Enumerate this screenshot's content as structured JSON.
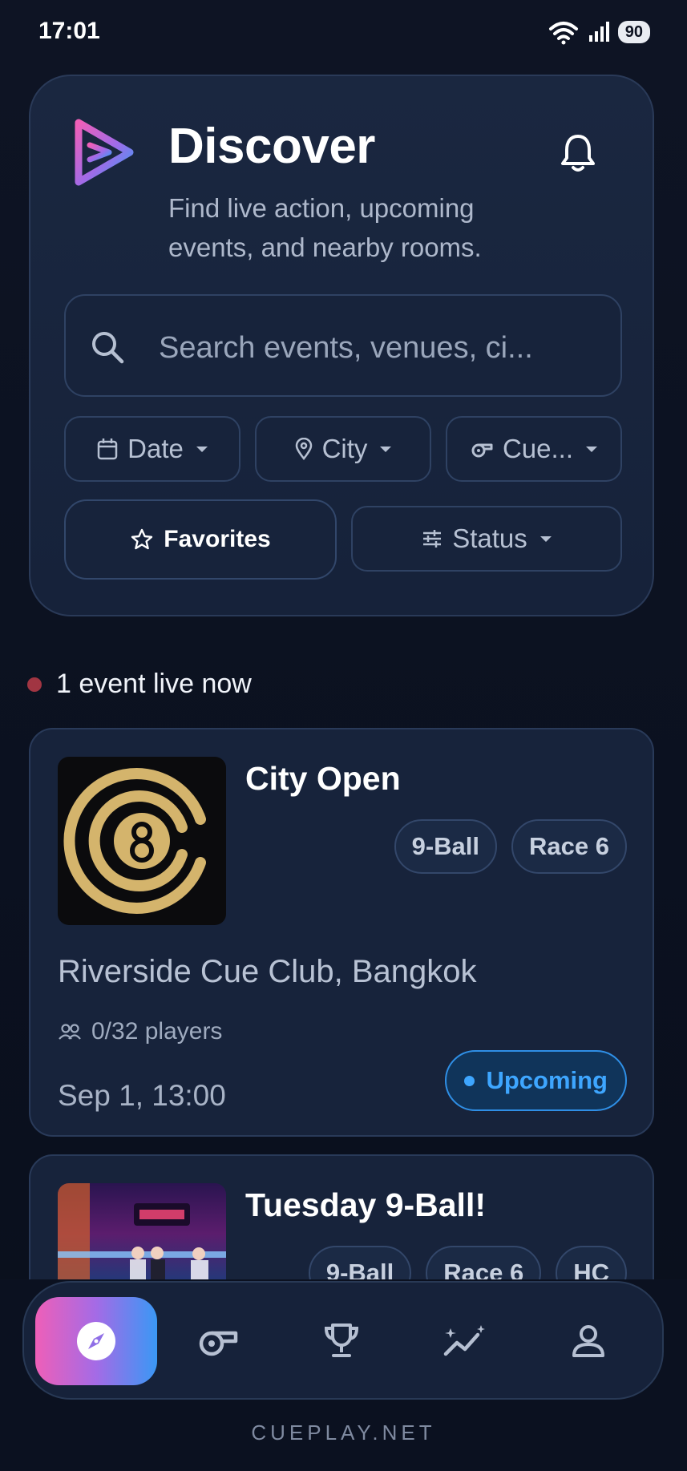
{
  "status_bar": {
    "time": "17:01",
    "battery": "90"
  },
  "header": {
    "title": "Discover",
    "subtitle": "Find live action, upcoming events, and nearby rooms.",
    "search_placeholder": "Search events, venues, ci..."
  },
  "filters": {
    "date": "Date",
    "city": "City",
    "cue": "Cue...",
    "favorites": "Favorites",
    "status": "Status"
  },
  "live": {
    "text": "1 event live now"
  },
  "events": [
    {
      "title": "City Open",
      "tags": [
        "9-Ball",
        "Race 6"
      ],
      "venue": "Riverside Cue Club, Bangkok",
      "players": "0/32 players",
      "date": "Sep 1, 13:00",
      "status": "Upcoming"
    },
    {
      "title": "Tuesday 9-Ball!",
      "tags": [
        "9-Ball",
        "Race 6",
        "HC"
      ]
    }
  ],
  "nav": {
    "items": [
      "discover",
      "whistle",
      "trophy",
      "stats",
      "profile"
    ]
  },
  "footer": "CUEPLAY.NET",
  "colors": {
    "accent_pink": "#ee5fb8",
    "accent_blue": "#3a98f5",
    "upcoming": "#3ea6ff",
    "live": "#a13542"
  }
}
